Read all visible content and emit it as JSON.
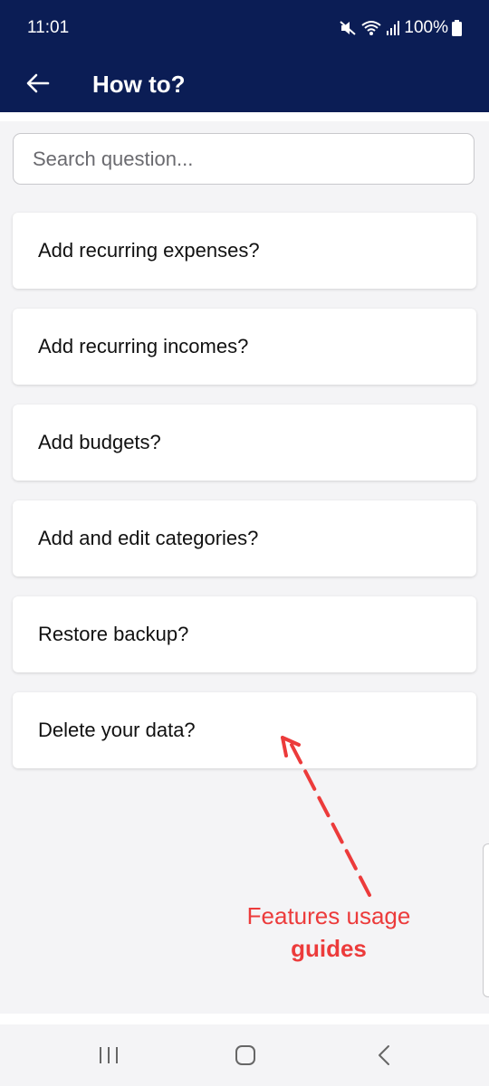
{
  "status_bar": {
    "time": "11:01",
    "battery": "100%",
    "icons": [
      "mute-icon",
      "wifi-icon",
      "signal-icon",
      "battery-icon"
    ]
  },
  "header": {
    "title": "How to?",
    "back_icon": "back-arrow-icon"
  },
  "search": {
    "placeholder": "Search question...",
    "value": ""
  },
  "questions": [
    "Add recurring expenses?",
    "Add recurring incomes?",
    "Add budgets?",
    "Add and edit categories?",
    "Restore backup?",
    "Delete your data?"
  ],
  "annotation": {
    "line1": "Features usage",
    "line2": "guides",
    "color": "#ec3b3b"
  },
  "nav_bar": {
    "icons": [
      "recents-icon",
      "home-icon",
      "back-icon"
    ]
  },
  "colors": {
    "primary": "#0b1d55",
    "background": "#f4f4f6"
  }
}
